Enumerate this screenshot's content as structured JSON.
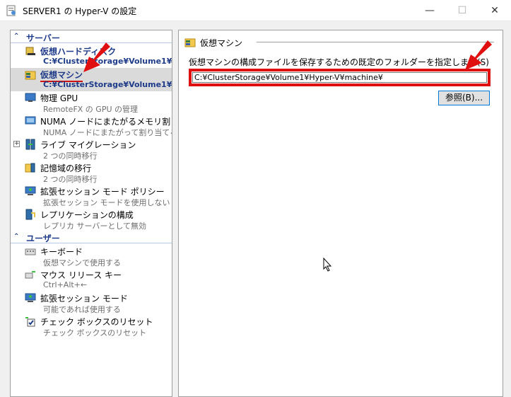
{
  "window": {
    "title": "SERVER1 の Hyper-V の設定",
    "minimize_glyph": "—",
    "maximize_glyph": "☐",
    "close_glyph": "✕"
  },
  "sidebar": {
    "server_section": {
      "chevron": "⌃",
      "label": "サーバー"
    },
    "user_section": {
      "chevron": "⌃",
      "label": "ユーザー"
    },
    "server_items": [
      {
        "name": "仮想ハードディスク",
        "sub": "C:¥ClusterStorage¥Volume1¥...",
        "icon": "hard-disk-icon"
      },
      {
        "name": "仮想マシン",
        "sub": "C:¥ClusterStorage¥Volume1¥...",
        "icon": "virtual-machine-folder-icon"
      },
      {
        "name": "物理 GPU",
        "sub": "RemoteFX の GPU の管理",
        "icon": "gpu-monitor-icon"
      },
      {
        "name": "NUMA ノードにまたがるメモリ割り当て",
        "sub": "NUMA ノードにまたがって割り当てる",
        "icon": "numa-icon"
      },
      {
        "name": "ライブ マイグレーション",
        "sub": "2 つの同時移行",
        "icon": "live-migration-icon",
        "expander": "+"
      },
      {
        "name": "記憶域の移行",
        "sub": "2 つの同時移行",
        "icon": "storage-migration-icon"
      },
      {
        "name": "拡張セッション モード ポリシー",
        "sub": "拡張セッション モードを使用しない",
        "icon": "enhanced-session-icon"
      },
      {
        "name": "レプリケーションの構成",
        "sub": "レプリカ サーバーとして無効",
        "icon": "replication-icon"
      }
    ],
    "user_items": [
      {
        "name": "キーボード",
        "sub": "仮想マシンで使用する",
        "icon": "keyboard-icon"
      },
      {
        "name": "マウス リリース キー",
        "sub": "Ctrl+Alt+←",
        "icon": "mouse-release-icon"
      },
      {
        "name": "拡張セッション モード",
        "sub": "可能であれば使用する",
        "icon": "enhanced-session-icon"
      },
      {
        "name": "チェック ボックスのリセット",
        "sub": "チェック ボックスのリセット",
        "icon": "checkbox-reset-icon"
      }
    ]
  },
  "main": {
    "group_title": "仮想マシン",
    "description": "仮想マシンの構成ファイルを保存するための既定のフォルダーを指定します(S)",
    "path_value": "C:¥ClusterStorage¥Volume1¥Hyper-V¥machine¥",
    "browse_label": "参照(B)..."
  },
  "colors": {
    "annotation_red": "#e01010",
    "section_blue": "#1e3b8a",
    "selected_bg": "#dadada"
  }
}
